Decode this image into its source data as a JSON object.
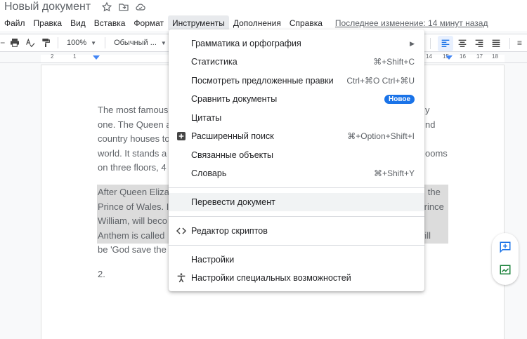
{
  "title_bar": {
    "doc_title": "Новый документ",
    "icons": [
      "star-icon",
      "folder-move-icon",
      "cloud-status-icon"
    ]
  },
  "menubar": {
    "items": [
      "Файл",
      "Правка",
      "Вид",
      "Вставка",
      "Формат",
      "Инструменты",
      "Дополнения",
      "Справка"
    ],
    "active": "Инструменты",
    "last_edit": "Последнее изменение: 14 минут назад"
  },
  "toolbar": {
    "zoom": "100%",
    "style": "Обычный ...",
    "left_icons": [
      "redo-icon",
      "print-icon",
      "spellcheck-icon",
      "paint-format-icon"
    ],
    "right_icons": [
      "align-left-icon",
      "align-center-icon",
      "align-right-icon",
      "align-justify-icon",
      "more-icon"
    ]
  },
  "ruler": {
    "left_numbers": [
      "2",
      "1"
    ],
    "right_numbers": [
      "14",
      "15",
      "16",
      "17",
      "18"
    ]
  },
  "document": {
    "para1": [
      "The most famous",
      "one. The Queen a",
      "country houses to",
      "world. It stands a",
      "on three floors, 4"
    ],
    "para1_right": [
      "y",
      "nd",
      "",
      "ooms",
      ""
    ],
    "para2": [
      "After Queen Eliza",
      "Prince of Wales. I",
      "William, will beco",
      "Anthem is called",
      "be 'God save the"
    ],
    "para2_right": [
      "s, the",
      "Prince",
      "",
      "will",
      ""
    ],
    "list_marker": "2."
  },
  "tools_menu": {
    "items": [
      {
        "label": "Грамматика и орфография",
        "shortcut": "",
        "submenu": true
      },
      {
        "label": "Статистика",
        "shortcut": "⌘+Shift+C"
      },
      {
        "label": "Посмотреть предложенные правки",
        "shortcut": "Ctrl+⌘O Ctrl+⌘U"
      },
      {
        "label": "Сравнить документы",
        "badge": "Новое"
      },
      {
        "label": "Цитаты",
        "shortcut": ""
      },
      {
        "label": "Расширенный поиск",
        "shortcut": "⌘+Option+Shift+I",
        "icon": "explore-plus-icon"
      },
      {
        "label": "Связанные объекты",
        "shortcut": ""
      },
      {
        "label": "Словарь",
        "shortcut": "⌘+Shift+Y"
      },
      {
        "label": "Перевести документ",
        "shortcut": ""
      },
      {
        "label": "Редактор скриптов",
        "shortcut": "",
        "icon": "code-icon"
      },
      {
        "label": "Настройки",
        "shortcut": ""
      },
      {
        "label": "Настройки специальных возможностей",
        "shortcut": "",
        "icon": "accessibility-icon"
      }
    ]
  },
  "colors": {
    "accent": "#1a73e8",
    "align_active": "#1a73e8",
    "highlight": "#dcdcdc"
  }
}
